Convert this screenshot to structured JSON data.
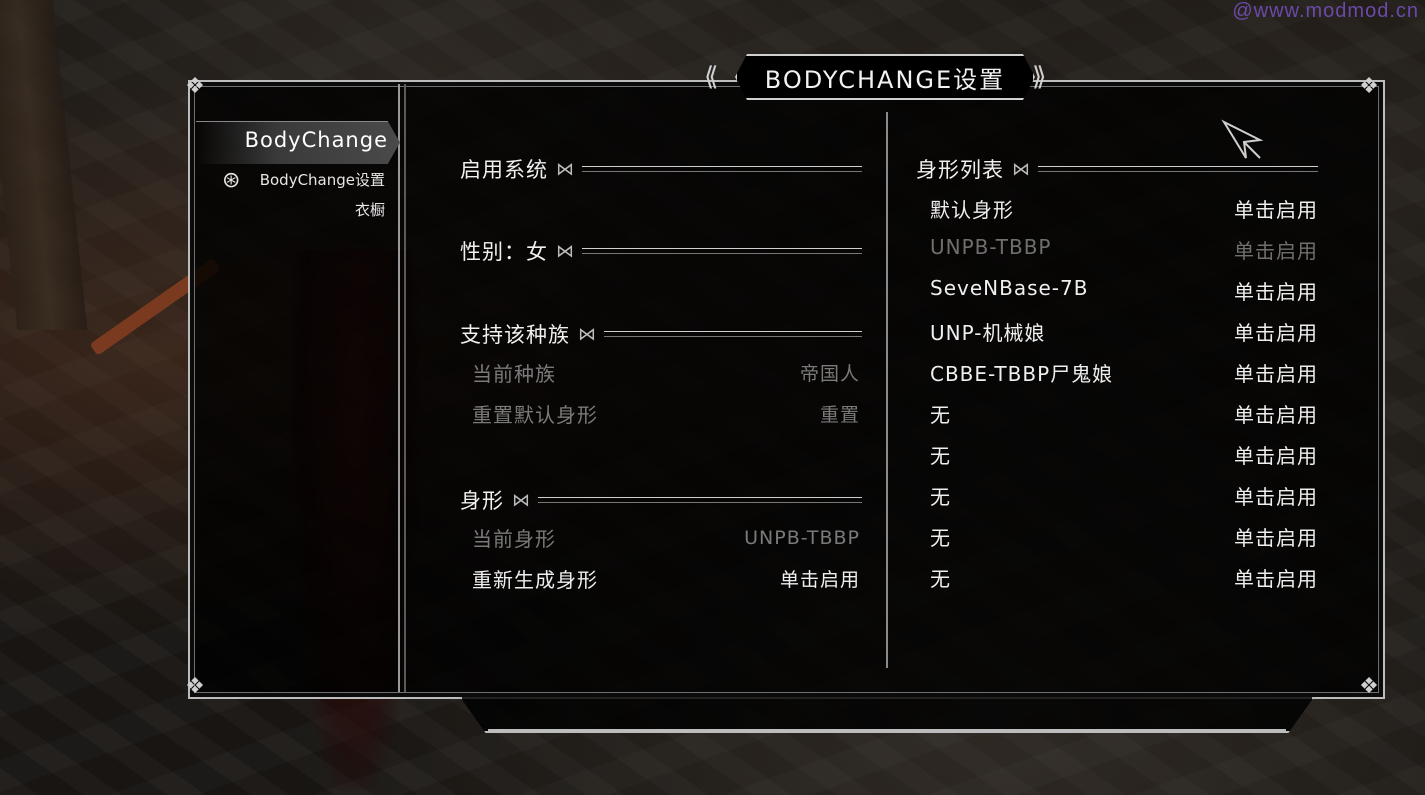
{
  "watermark": "@www.modmod.cn",
  "title": "BODYCHANGE设置",
  "nav": {
    "active": "BodyChange",
    "items": [
      "BodyChange设置",
      "衣橱"
    ]
  },
  "left_panel": {
    "sections": [
      {
        "heading": "启用系统"
      },
      {
        "heading": "性别：女"
      },
      {
        "heading": "支持该种族",
        "rows": [
          {
            "label": "当前种族",
            "value": "帝国人",
            "enabled": false
          },
          {
            "label": "重置默认身形",
            "value": "重置",
            "enabled": false
          }
        ]
      },
      {
        "heading": "身形",
        "rows": [
          {
            "label": "当前身形",
            "value": "UNPB-TBBP",
            "enabled": false
          },
          {
            "label": "重新生成身形",
            "value": "单击启用",
            "enabled": true
          }
        ]
      }
    ]
  },
  "right_panel": {
    "heading": "身形列表",
    "items": [
      {
        "name": "默认身形",
        "action": "单击启用",
        "enabled": true
      },
      {
        "name": "UNPB-TBBP",
        "action": "单击启用",
        "enabled": false
      },
      {
        "name": "SeveNBase-7B",
        "action": "单击启用",
        "enabled": true
      },
      {
        "name": "UNP-机械娘",
        "action": "单击启用",
        "enabled": true
      },
      {
        "name": "CBBE-TBBP尸鬼娘",
        "action": "单击启用",
        "enabled": true
      },
      {
        "name": "无",
        "action": "单击启用",
        "enabled": true
      },
      {
        "name": "无",
        "action": "单击启用",
        "enabled": true
      },
      {
        "name": "无",
        "action": "单击启用",
        "enabled": true
      },
      {
        "name": "无",
        "action": "单击启用",
        "enabled": true
      },
      {
        "name": "无",
        "action": "单击启用",
        "enabled": true
      }
    ]
  },
  "colors": {
    "text": "#efefef",
    "disabled": "#7a7a7a",
    "frame": "#bdbdbd"
  }
}
